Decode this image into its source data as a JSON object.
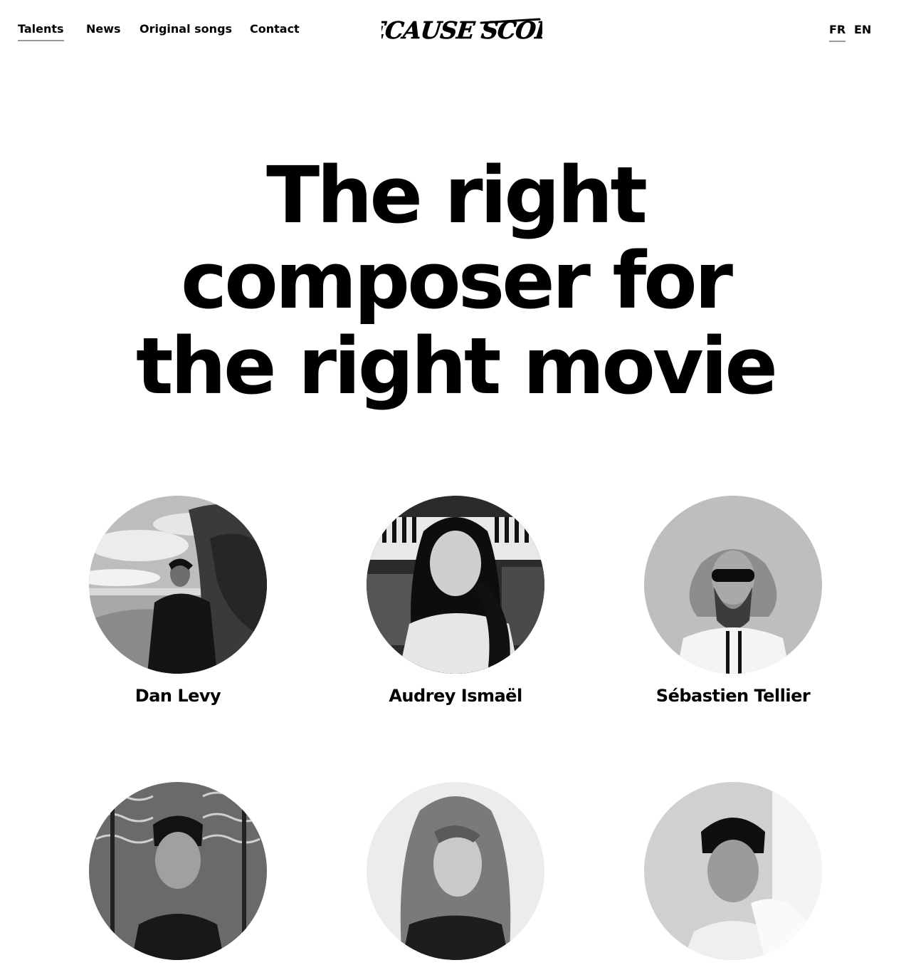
{
  "nav": {
    "links": [
      {
        "label": "Talents",
        "active": true
      },
      {
        "label": "News"
      },
      {
        "label": "Original songs"
      },
      {
        "label": "Contact"
      }
    ],
    "logo_text": "BECAUSE SCORE",
    "languages": [
      {
        "label": "FR",
        "active": true
      },
      {
        "label": "EN"
      }
    ]
  },
  "hero": {
    "lines": [
      "The right",
      "composer for",
      "the right movie"
    ]
  },
  "talents": [
    {
      "name": "Dan Levy"
    },
    {
      "name": "Audrey Ismaël"
    },
    {
      "name": "Sébastien Tellier"
    },
    {
      "name": ""
    },
    {
      "name": ""
    },
    {
      "name": ""
    }
  ],
  "colors": {
    "text": "#000000",
    "background": "#ffffff",
    "underline": "#9a9a9a"
  }
}
